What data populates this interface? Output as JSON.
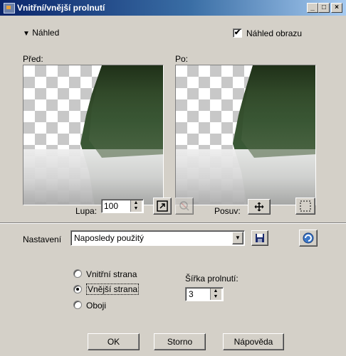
{
  "window": {
    "title": "Vnitřní/vnější prolnutí",
    "minimize_glyph": "_",
    "maximize_glyph": "□",
    "close_glyph": "×"
  },
  "preview_toggle": {
    "arrow": "▼",
    "label": "Náhled"
  },
  "preview_image_checkbox": {
    "label": "Náhled obrazu",
    "checked": true,
    "mark": "✔"
  },
  "before": {
    "label": "Před:"
  },
  "after": {
    "label": "Po:"
  },
  "zoom": {
    "label": "Lupa:",
    "value": "100",
    "up": "▲",
    "down": "▼"
  },
  "pan": {
    "label": "Posuv:"
  },
  "settings": {
    "label": "Nastavení",
    "selected": "Naposledy použitý",
    "dropdown_arrow": "▼"
  },
  "options": {
    "inside": "Vnitřní strana",
    "outside": "Vnější strana",
    "both": "Oboji",
    "selected": "outside"
  },
  "feather": {
    "label": "Šířka prolnutí:",
    "value": "3",
    "up": "▲",
    "down": "▼"
  },
  "buttons": {
    "ok": "OK",
    "cancel": "Storno",
    "help": "Nápověda"
  }
}
